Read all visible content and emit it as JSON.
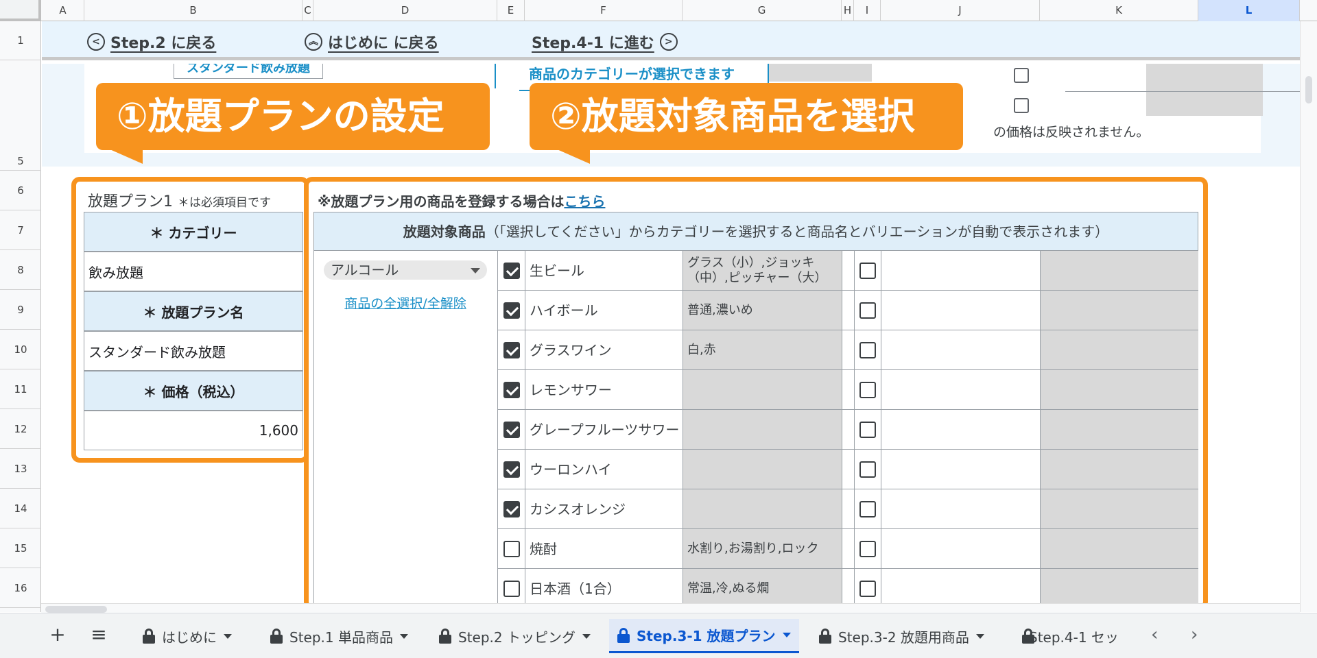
{
  "columns": [
    "A",
    "B",
    "C",
    "D",
    "E",
    "F",
    "G",
    "H",
    "I",
    "J",
    "K",
    "L"
  ],
  "selected_column": "L",
  "rows": [
    "1",
    "5",
    "6",
    "7",
    "8",
    "9",
    "10",
    "11",
    "12",
    "13",
    "14",
    "15",
    "16"
  ],
  "nav": {
    "back_step2": "Step.2 に戻る",
    "back_intro": "はじめに に戻る",
    "next_step41": "Step.4-1 に進む"
  },
  "scrolled_top": {
    "plan_name_cut": "スタンダード飲み放題",
    "category_hint": "商品のカテゴリーが選択できます",
    "price_note": "の価格は反映されません。"
  },
  "callouts": {
    "plan_settings": "①放題プランの設定",
    "select_items": "②放題対象商品を選択"
  },
  "plan": {
    "title": "放題プラン1",
    "required_note": "＊は必須項目です",
    "category_label": "＊ カテゴリー",
    "category_value": "飲み放題",
    "name_label": "＊ 放題プラン名",
    "name_value": "スタンダード飲み放題",
    "price_label": "＊ 価格（税込）",
    "price_value": "1,600"
  },
  "products": {
    "register_note": "※放題プラン用の商品を登録する場合は",
    "register_link": "こちら",
    "header_bold": "放題対象商品",
    "header_rest": "（「選択してください」からカテゴリーを選択すると商品名とバリエーションが自動で表示されます）",
    "category_select": "アルコール",
    "select_all_link": "商品の全選択/全解除",
    "items": [
      {
        "name": "生ビール",
        "variation": "グラス（小）,ジョッキ（中）,ピッチャー（大）",
        "checked": true
      },
      {
        "name": "ハイボール",
        "variation": "普通,濃いめ",
        "checked": true
      },
      {
        "name": "グラスワイン",
        "variation": "白,赤",
        "checked": true
      },
      {
        "name": "レモンサワー",
        "variation": "",
        "checked": true
      },
      {
        "name": "グレープフルーツサワー",
        "variation": "",
        "checked": true
      },
      {
        "name": "ウーロンハイ",
        "variation": "",
        "checked": true
      },
      {
        "name": "カシスオレンジ",
        "variation": "",
        "checked": true
      },
      {
        "name": "焼酎",
        "variation": "水割り,お湯割り,ロック",
        "checked": false
      },
      {
        "name": "日本酒（1合）",
        "variation": "常温,冷,ぬる燗",
        "checked": false
      }
    ]
  },
  "tabs": [
    {
      "label": "はじめに",
      "active": false
    },
    {
      "label": "Step.1 単品商品",
      "active": false
    },
    {
      "label": "Step.2 トッピング",
      "active": false
    },
    {
      "label": "Step.3-1 放題プラン",
      "active": true
    },
    {
      "label": "Step.3-2 放題用商品",
      "active": false
    },
    {
      "label": "Step.4-1 セッ",
      "active": false
    }
  ],
  "colors": {
    "accent_orange": "#f7931e",
    "header_blue": "#dfeef9",
    "link_blue": "#1a8fc7",
    "active_tab": "#0b57d0"
  }
}
